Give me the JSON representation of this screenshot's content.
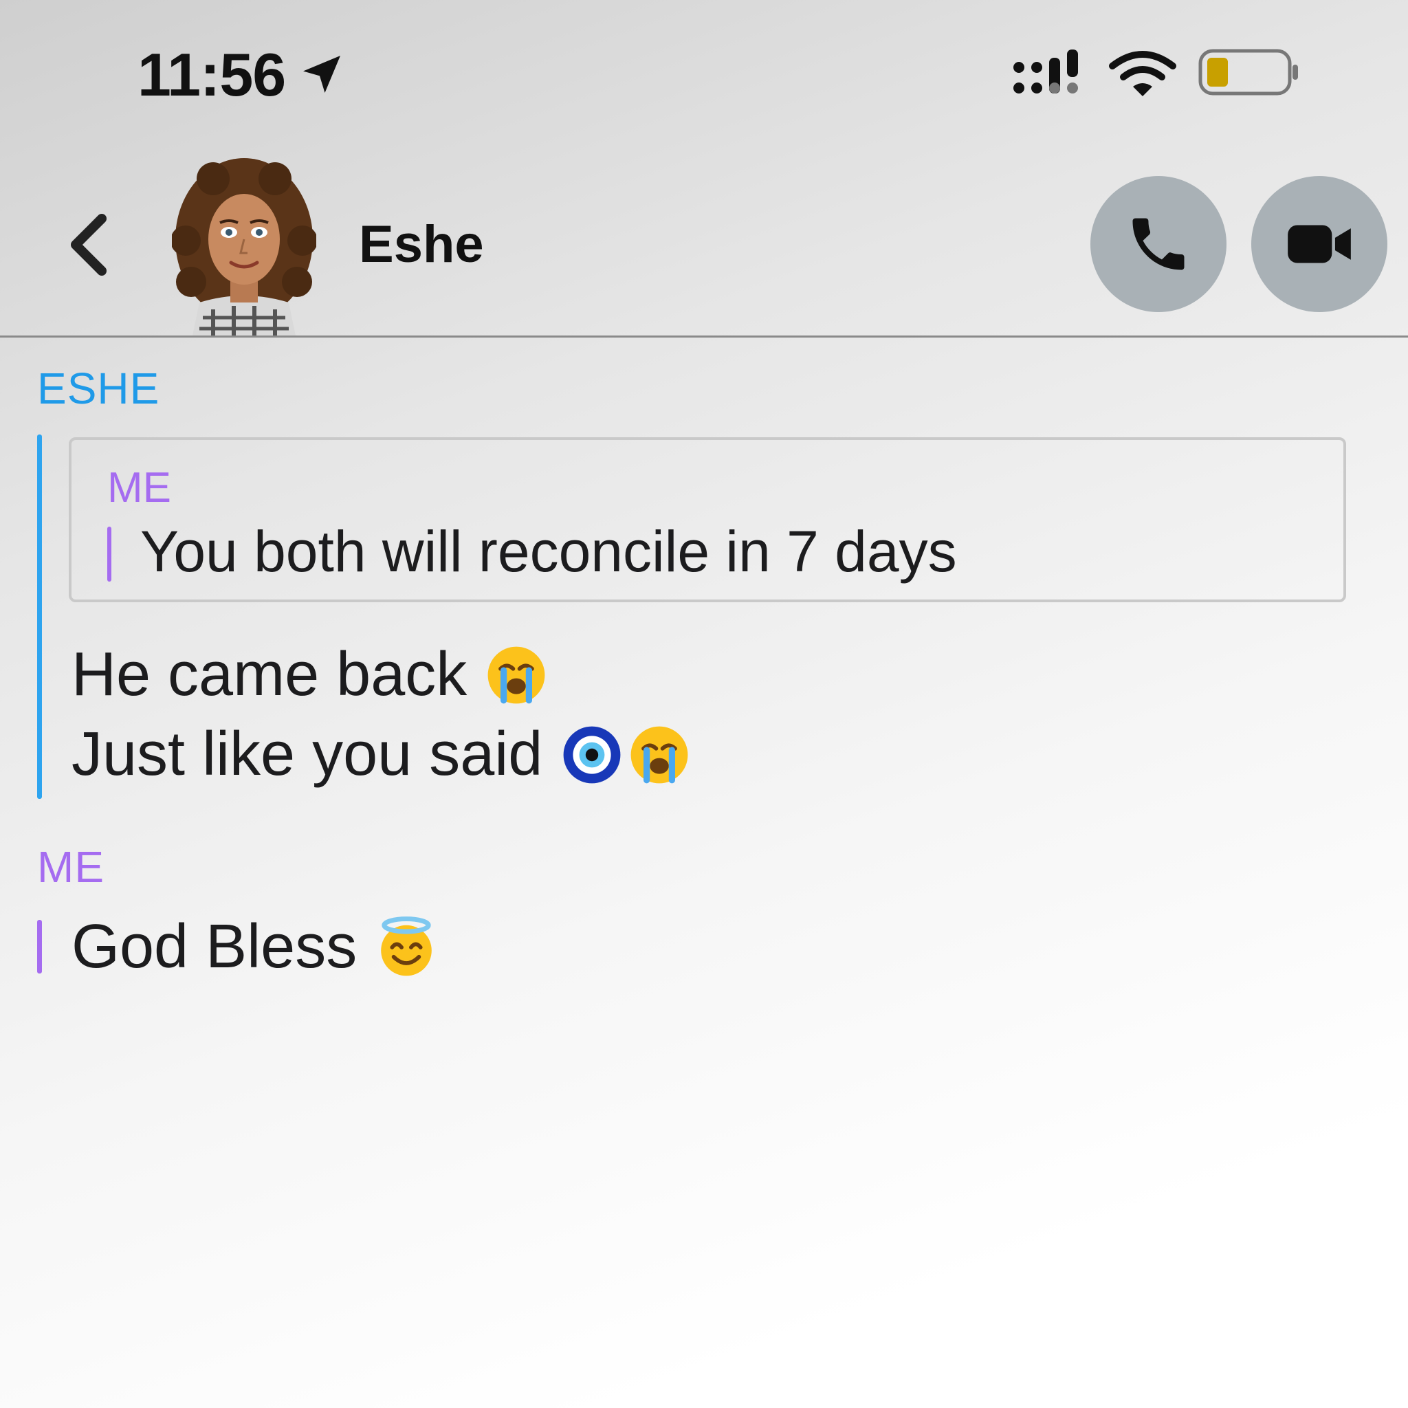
{
  "status_bar": {
    "time": "11:56",
    "icons": [
      "location-arrow-icon",
      "cellular-signal-icon",
      "wifi-icon",
      "battery-low-icon"
    ],
    "battery_color": "#c8a000"
  },
  "header": {
    "contact_name": "Eshe",
    "icons": [
      "back-chevron-icon",
      "phone-icon",
      "video-camera-icon"
    ],
    "button_color": "#a9b1b6"
  },
  "conversation": {
    "messages": [
      {
        "sender": "ESHE",
        "quote": {
          "sender": "ME",
          "text": "You both will reconcile in 7 days"
        },
        "lines": [
          {
            "text": "He came back",
            "emojis": [
              "loudly-crying-face-emoji"
            ]
          },
          {
            "text": "Just like you said",
            "emojis": [
              "nazar-amulet-emoji",
              "loudly-crying-face-emoji"
            ]
          }
        ]
      },
      {
        "sender": "ME",
        "lines": [
          {
            "text": "God Bless",
            "emojis": [
              "smiling-face-with-halo-emoji"
            ]
          }
        ]
      }
    ]
  },
  "colors": {
    "eshe_accent": "#1f9ae8",
    "me_accent": "#a56cf0"
  }
}
